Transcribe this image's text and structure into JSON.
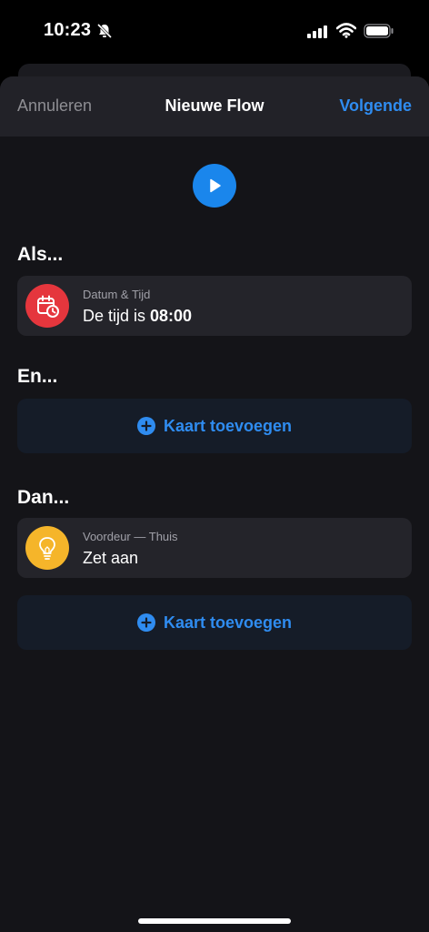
{
  "status": {
    "time": "10:23"
  },
  "nav": {
    "cancel": "Annuleren",
    "title": "Nieuwe Flow",
    "next": "Volgende"
  },
  "when": {
    "title": "Als...",
    "card": {
      "category": "Datum & Tijd",
      "text_prefix": "De tijd is ",
      "text_value": "08:00",
      "icon": "calendar-clock-icon",
      "color": "#e5363d"
    }
  },
  "and": {
    "title": "En...",
    "add_label": "Kaart toevoegen"
  },
  "then": {
    "title": "Dan...",
    "card": {
      "device": "Voordeur — Thuis",
      "action": "Zet aan",
      "icon": "lightbulb-icon",
      "color": "#f5b52a"
    },
    "add_label": "Kaart toevoegen"
  },
  "colors": {
    "accent": "#2f8cf0",
    "play": "#1a86ec"
  }
}
